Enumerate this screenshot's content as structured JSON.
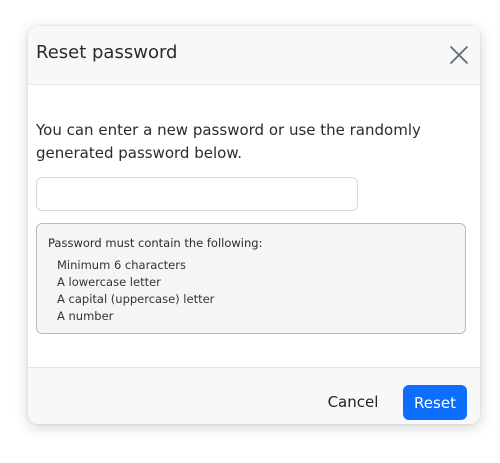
{
  "dialog": {
    "title": "Reset password",
    "close_icon": "close-icon"
  },
  "body": {
    "intro_text": "You can enter a new password or use the randomly generated password below.",
    "password_input": {
      "value": "",
      "placeholder": ""
    },
    "requirements": {
      "title": "Password must contain the following:",
      "items": [
        "Minimum 6 characters",
        "A lowercase letter",
        "A capital (uppercase) letter",
        "A number"
      ]
    }
  },
  "footer": {
    "cancel_label": "Cancel",
    "reset_label": "Reset"
  },
  "colors": {
    "primary": "#0d6efd",
    "header_bg": "#f7f8f9",
    "box_bg": "#f4f5f6"
  }
}
